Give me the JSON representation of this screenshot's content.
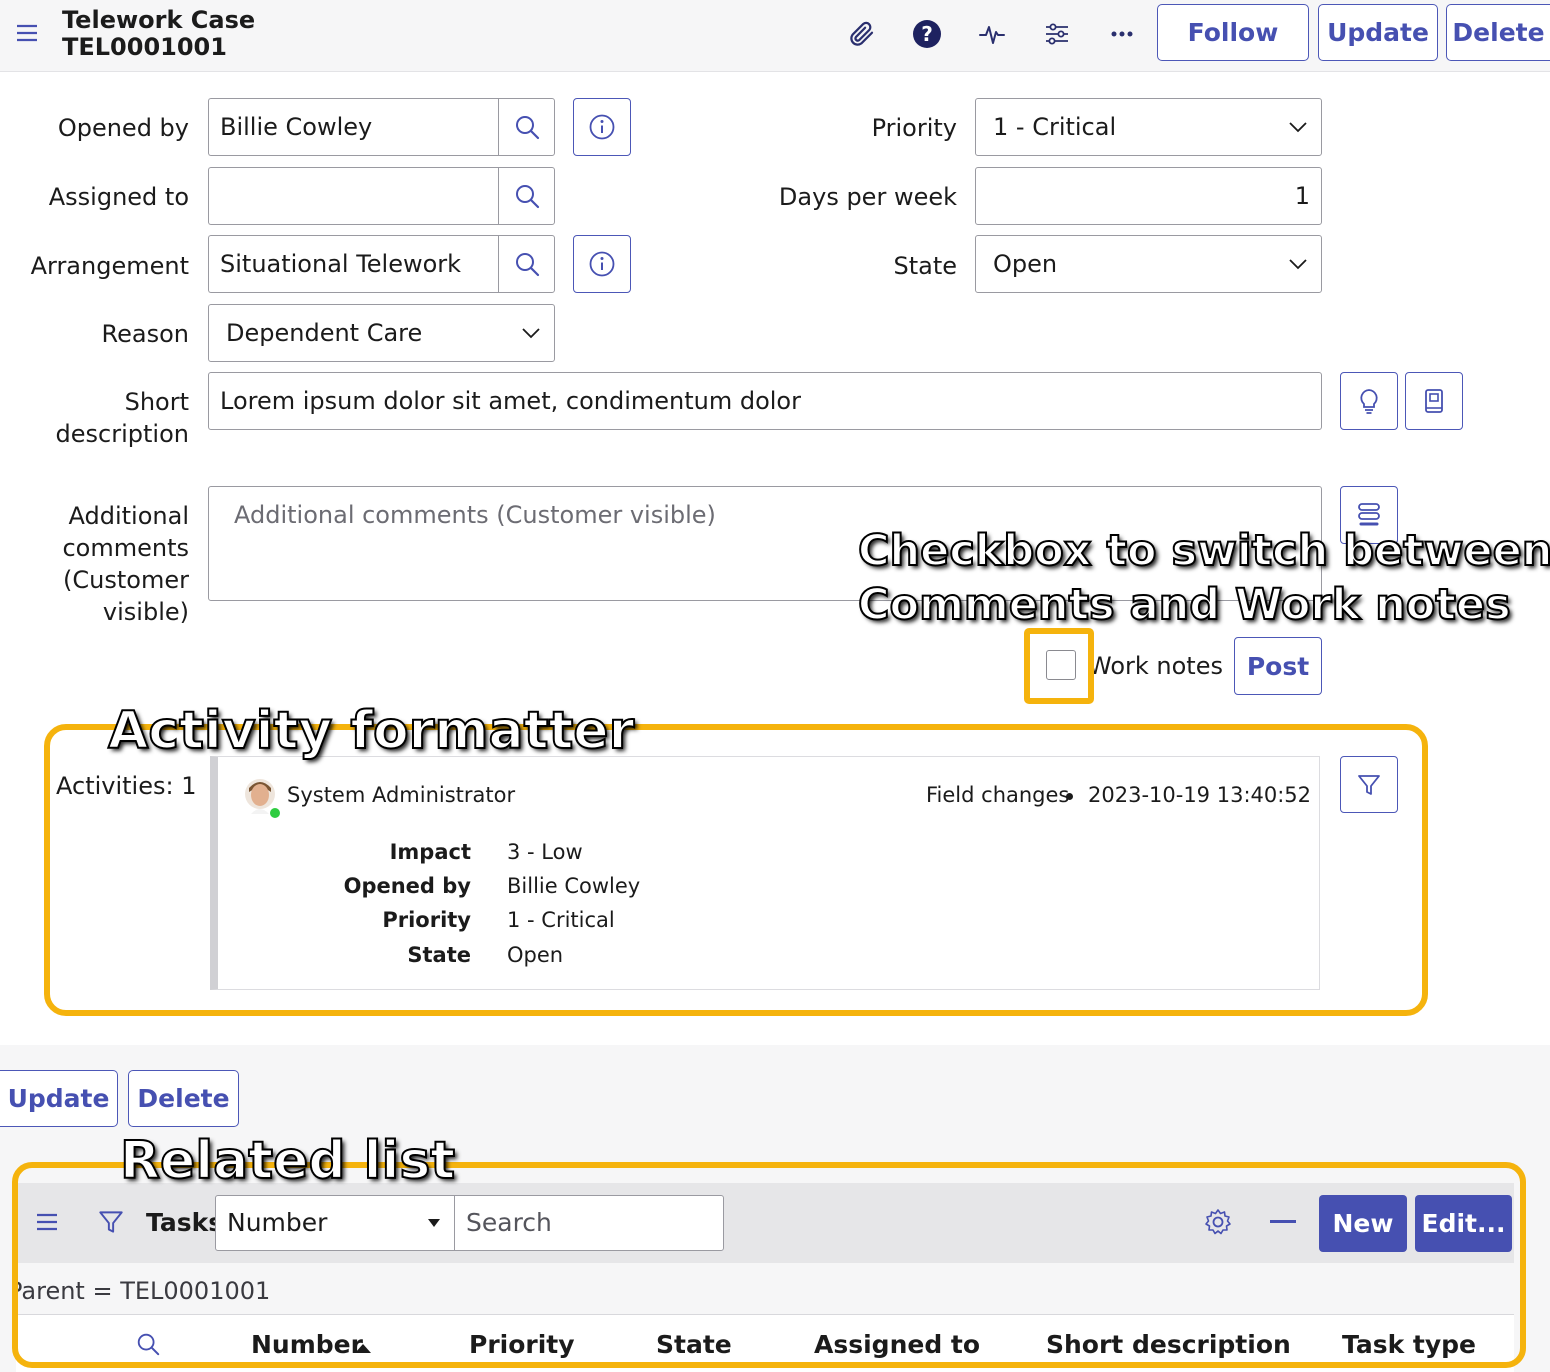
{
  "header": {
    "record_type": "Telework Case",
    "record_number": "TEL0001001",
    "follow_label": "Follow",
    "update_label": "Update",
    "delete_label": "Delete",
    "icons": [
      "menu-icon",
      "attachment-icon",
      "help-icon",
      "activity-pulse-icon",
      "personalize-icon",
      "more-icon"
    ]
  },
  "form": {
    "opened_by": {
      "label": "Opened by",
      "value": "Billie Cowley"
    },
    "assigned_to": {
      "label": "Assigned to",
      "value": ""
    },
    "arrangement": {
      "label": "Arrangement",
      "value": "Situational Telework"
    },
    "reason": {
      "label": "Reason",
      "value": "Dependent Care"
    },
    "priority": {
      "label": "Priority",
      "value": "1 - Critical"
    },
    "days_per_week": {
      "label": "Days per week",
      "value": "1"
    },
    "state": {
      "label": "State",
      "value": "Open"
    },
    "short_description": {
      "label_line1": "Short",
      "label_line2": "description",
      "value": "Lorem ipsum dolor sit amet, condimentum dolor"
    },
    "additional_comments": {
      "label_lines": [
        "Additional",
        "comments",
        "(Customer",
        "visible)"
      ],
      "placeholder": "Additional comments (Customer visible)"
    },
    "work_notes_label": "Work notes",
    "post_label": "Post"
  },
  "annotations": {
    "checkbox_line1": "Checkbox to switch between",
    "checkbox_line2": "Comments and Work notes",
    "activity": "Activity formatter",
    "related": "Related list",
    "highlight_color": "#f5b30d"
  },
  "activity": {
    "count_label": "Activities: 1",
    "author": "System Administrator",
    "type": "Field changes",
    "timestamp": "2023-10-19 13:40:52",
    "changes": [
      {
        "field": "Impact",
        "value": "3 - Low"
      },
      {
        "field": "Opened by",
        "value": "Billie Cowley"
      },
      {
        "field": "Priority",
        "value": "1 - Critical"
      },
      {
        "field": "State",
        "value": "Open"
      }
    ]
  },
  "bottom_buttons": {
    "update_label": "Update",
    "delete_label": "Delete"
  },
  "related_list": {
    "title": "Tasks",
    "search_field": "Number",
    "search_placeholder": "Search",
    "new_label": "New",
    "edit_label": "Edit...",
    "filter_text": "Parent = TEL0001001",
    "columns": [
      "Number",
      "Priority",
      "State",
      "Assigned to",
      "Short description",
      "Task type"
    ],
    "sort_column": "Number"
  },
  "colors": {
    "accent": "#4650b1",
    "presence": "#2ecc40"
  }
}
